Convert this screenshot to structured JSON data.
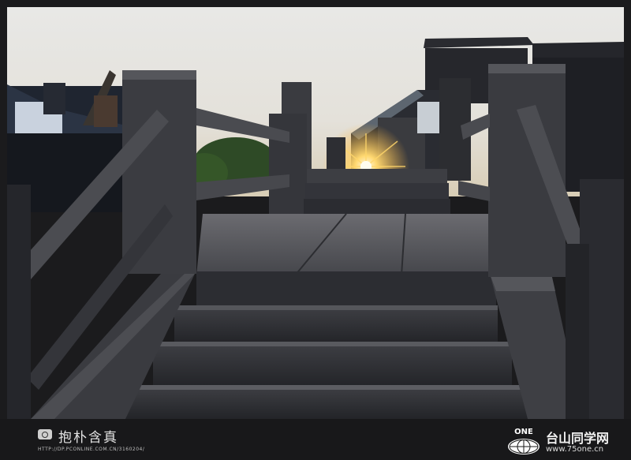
{
  "photo": {
    "scene": "stone-bridge-steps-at-sunset"
  },
  "watermark": {
    "signature": "抱朴含真",
    "signature_url": "HTTP://DP.PCONLINE.COM.CN/3160204/",
    "brand_logo_text": "ONE",
    "brand_name": "台山同学网",
    "brand_url": "www.75one.cn"
  },
  "colors": {
    "frame": "#1b1b1d",
    "sky": "#e4e3de",
    "sun": "#ffcf60",
    "stone_dark": "#2a2b2f",
    "stone_mid": "#4a4b50"
  }
}
